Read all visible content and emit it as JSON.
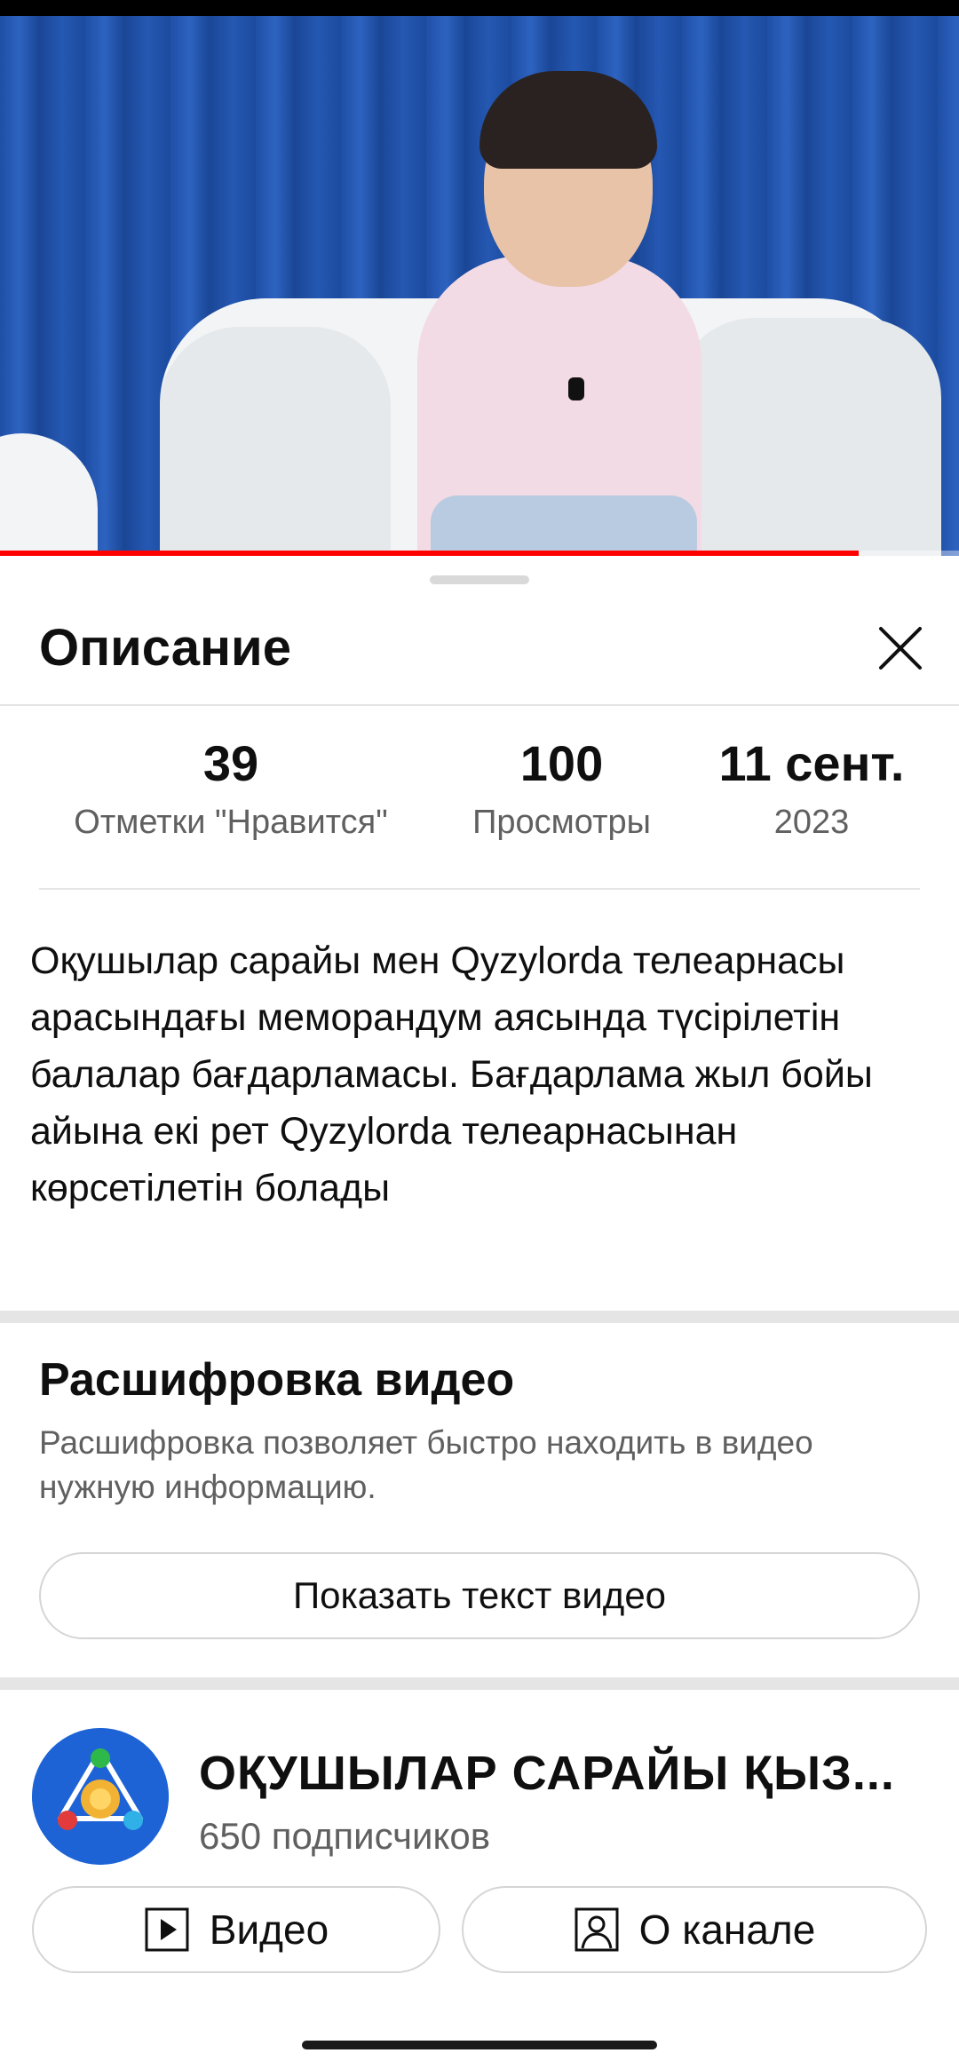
{
  "player": {
    "progress": 0.895
  },
  "description_sheet": {
    "title": "Описание",
    "close_icon": "close-icon",
    "stats": {
      "likes_value": "39",
      "likes_label": "Отметки \"Нравится\"",
      "views_value": "100",
      "views_label": "Просмотры",
      "date_value": "11 сент.",
      "date_year": "2023"
    },
    "description_text": "Оқушылар сарайы мен Qyzylorda телеарнасы арасындағы меморандум аясында түсірілетін балалар бағдарламасы. Бағдарлама жыл бойы айына екі рет Qyzylorda телеарнасынан көрсетілетін болады"
  },
  "transcript": {
    "title": "Расшифровка видео",
    "text": "Расшифровка позволяет быстро находить в видео нужную информацию.",
    "button_label": "Показать текст видео"
  },
  "channel": {
    "name": "ОҚУШЫЛАР САРАЙЫ ҚЫЗ...",
    "subscribers": "650 подписчиков",
    "video_button_label": "Видео",
    "video_button_icon": "play-square-icon",
    "about_button_label": "О канале",
    "about_button_icon": "person-square-icon"
  },
  "colors": {
    "progress": "#ff0000",
    "secondary_text": "#606060",
    "avatar_bg": "#1d63d6"
  }
}
